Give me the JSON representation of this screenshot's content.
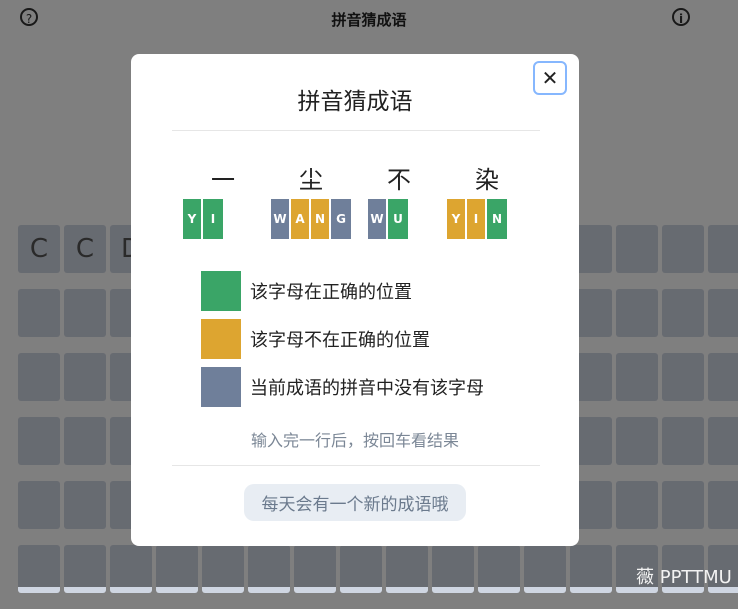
{
  "app": {
    "title": "拼音猜成语",
    "help_icon_glyph": "?",
    "info_icon_glyph": "i",
    "grid_rows": [
      [
        "C",
        "C",
        "D",
        "",
        "",
        "",
        "",
        "",
        "",
        "",
        "",
        "",
        "",
        "",
        "",
        ""
      ],
      [
        "",
        "",
        "",
        "",
        "",
        "",
        "",
        "",
        "",
        "",
        "",
        "",
        "",
        "",
        "",
        ""
      ],
      [
        "",
        "",
        "",
        "",
        "",
        "",
        "",
        "",
        "",
        "",
        "",
        "",
        "",
        "",
        "",
        ""
      ],
      [
        "",
        "",
        "",
        "",
        "",
        "",
        "",
        "",
        "",
        "",
        "",
        "",
        "",
        "",
        "",
        ""
      ],
      [
        "",
        "",
        "",
        "",
        "",
        "",
        "",
        "",
        "",
        "",
        "",
        "",
        "",
        "",
        "",
        ""
      ],
      [
        "",
        "",
        "",
        "",
        "",
        "",
        "",
        "",
        "",
        "",
        "",
        "",
        "",
        "",
        "",
        ""
      ]
    ]
  },
  "modal": {
    "title": "拼音猜成语",
    "close_glyph": "✕",
    "example": {
      "characters": [
        "一",
        "尘",
        "不",
        "染"
      ],
      "syllables": [
        [
          {
            "letter": "Y",
            "status": "green"
          },
          {
            "letter": "I",
            "status": "green"
          }
        ],
        [
          {
            "letter": "W",
            "status": "gray"
          },
          {
            "letter": "A",
            "status": "yellow"
          },
          {
            "letter": "N",
            "status": "yellow"
          },
          {
            "letter": "G",
            "status": "gray"
          }
        ],
        [
          {
            "letter": "W",
            "status": "gray"
          },
          {
            "letter": "U",
            "status": "green"
          }
        ],
        [
          {
            "letter": "Y",
            "status": "yellow"
          },
          {
            "letter": "I",
            "status": "yellow"
          },
          {
            "letter": "N",
            "status": "green"
          }
        ]
      ]
    },
    "legend": [
      {
        "color": "#3aa567",
        "label": "该字母在正确的位置"
      },
      {
        "color": "#dda530",
        "label": "该字母不在正确的位置"
      },
      {
        "color": "#6f7f9a",
        "label": "当前成语的拼音中没有该字母"
      }
    ],
    "hint": "输入完一行后，按回车看结果",
    "daily_label": "每天会有一个新的成语哦"
  },
  "watermark": "薇 PPTTMU"
}
